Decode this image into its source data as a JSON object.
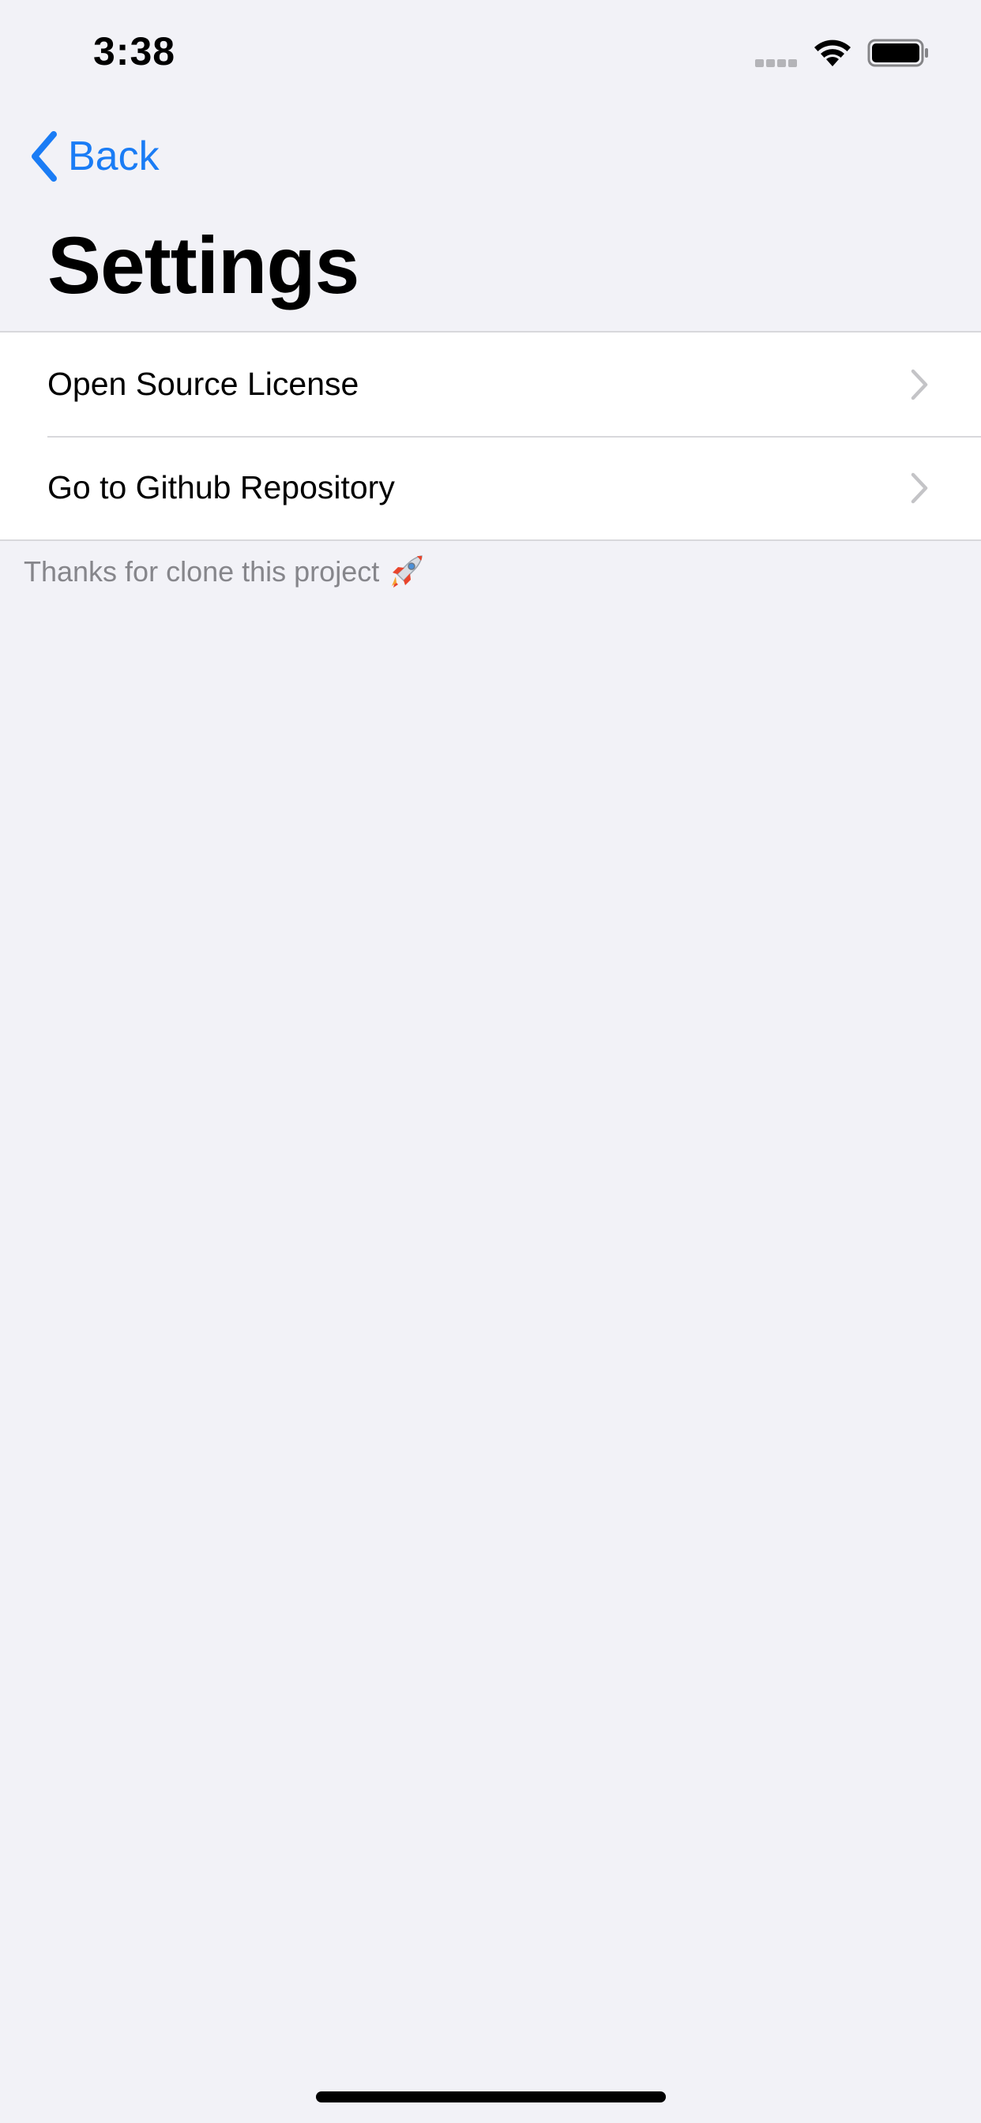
{
  "status_bar": {
    "time": "3:38",
    "icons": [
      "cellular-signal-icon",
      "wifi-icon",
      "battery-icon"
    ]
  },
  "nav": {
    "back_label": "Back",
    "back_icon": "chevron-left-icon"
  },
  "title": "Settings",
  "settings_list": {
    "items": [
      {
        "label": "Open Source License",
        "icon": "chevron-right-icon"
      },
      {
        "label": "Go to Github Repository",
        "icon": "chevron-right-icon"
      }
    ]
  },
  "footer": {
    "text": "Thanks for clone this project",
    "icon": "rocket-icon"
  },
  "colors": {
    "background": "#f2f2f7",
    "accent": "#1a7cf5",
    "secondary_text": "#86868b",
    "separator": "#d8d8dc"
  }
}
